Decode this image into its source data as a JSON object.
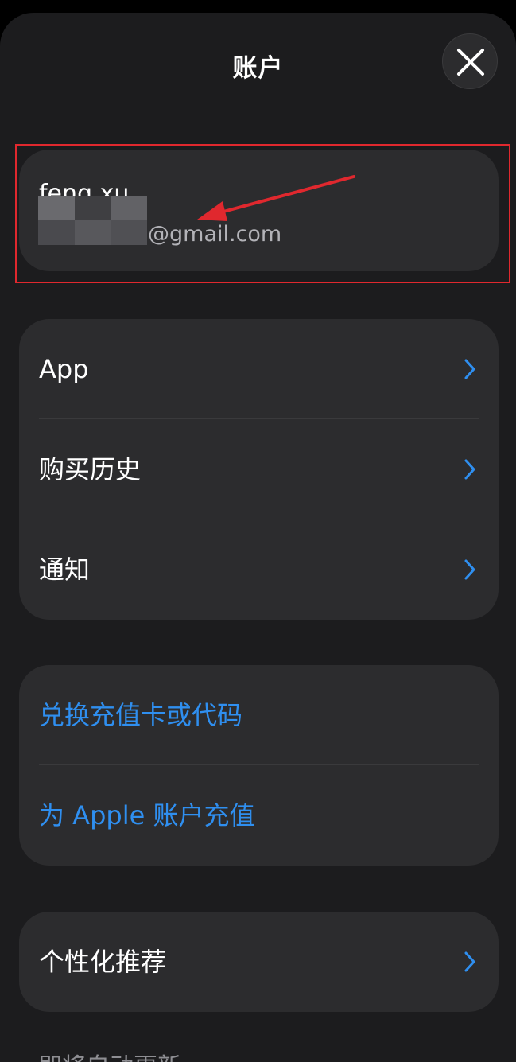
{
  "header": {
    "title": "账户",
    "close_icon": "close-icon"
  },
  "account": {
    "name": "feng xu",
    "email_suffix": "@gmail.com"
  },
  "annotation": {
    "highlight_color": "#e0282e",
    "arrow_icon": "red-arrow-icon"
  },
  "groups": {
    "main": [
      {
        "label": "App",
        "chevron_icon": "chevron-right-icon"
      },
      {
        "label": "购买历史",
        "chevron_icon": "chevron-right-icon"
      },
      {
        "label": "通知",
        "chevron_icon": "chevron-right-icon"
      }
    ],
    "funds": [
      {
        "label": "兑换充值卡或代码"
      },
      {
        "label": "为 Apple 账户充值"
      }
    ],
    "personal": [
      {
        "label": "个性化推荐",
        "chevron_icon": "chevron-right-icon"
      }
    ]
  },
  "footer": {
    "section_header": "即将自动更新"
  },
  "colors": {
    "background": "#1c1c1e",
    "card": "#2c2c2e",
    "accent": "#2f8ff0",
    "separator": "#3a3a3c"
  }
}
